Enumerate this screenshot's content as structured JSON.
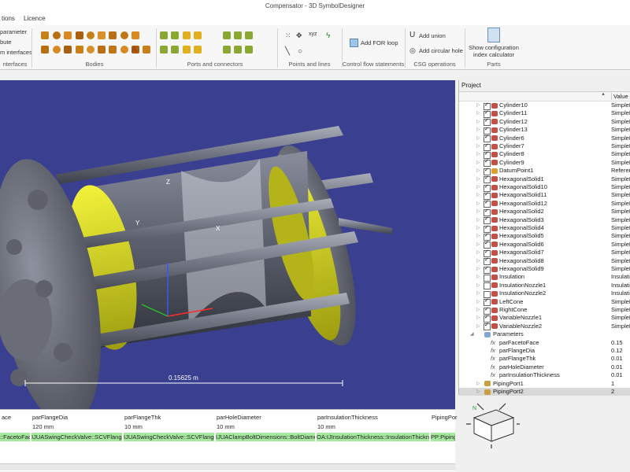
{
  "window": {
    "title": "Compensator - 3D SymbolDesigner"
  },
  "menu": {
    "items": [
      "tions",
      "Licence"
    ]
  },
  "ribbon": {
    "left_texts": [
      "parameter",
      "bute",
      "m interfaces"
    ],
    "groups": [
      "nterfaces",
      "Bodies",
      "Ports and connectors",
      "Points and lines",
      "Control flow statements",
      "CSG operations",
      "Parts"
    ],
    "add_for_loop": "Add FOR loop",
    "add_union": "Add union",
    "add_circular_hole": "Add circular hole",
    "show_config": "Show configuration index calculator"
  },
  "viewport": {
    "axes": {
      "x": "X",
      "y": "Y",
      "z": "Z"
    },
    "scale_label": "0.15625 m",
    "colors": {
      "background": "#3a3f8f",
      "metal": "#707482",
      "insulation": "#e5e51a"
    }
  },
  "grid": {
    "columns": [
      {
        "header": "ace",
        "value": "",
        "binding": "::FacetoFace"
      },
      {
        "header": "parFlangeDia",
        "value": "120 mm",
        "binding": "IJUASwingCheckValve::SCVFlangeDia"
      },
      {
        "header": "parFlangeThk",
        "value": "10 mm",
        "binding": "IJUASwingCheckValve::SCVFlangeThk"
      },
      {
        "header": "parHoleDiameter",
        "value": "10 mm",
        "binding": "IJUAClampBoltDimensions::BoltDiameter"
      },
      {
        "header": "parInsulationThickness",
        "value": "10 mm",
        "binding": "OA:IJInsulationThickness::InsulationThickness"
      },
      {
        "header": "PipingPor",
        "value": "",
        "binding": "PP:PipingP"
      }
    ]
  },
  "project": {
    "title": "Project",
    "value_header": "Value",
    "rows": [
      {
        "name": "Cylinder10",
        "value": "SimpleP",
        "type": "solid",
        "checked": true
      },
      {
        "name": "Cylinder11",
        "value": "SimpleP",
        "type": "solid",
        "checked": true
      },
      {
        "name": "Cylinder12",
        "value": "SimpleP",
        "type": "solid",
        "checked": true
      },
      {
        "name": "Cylinder13",
        "value": "SimpleP",
        "type": "solid",
        "checked": true
      },
      {
        "name": "Cylinder6",
        "value": "SimpleP",
        "type": "solid",
        "checked": true
      },
      {
        "name": "Cylinder7",
        "value": "SimpleP",
        "type": "solid",
        "checked": true
      },
      {
        "name": "Cylinder8",
        "value": "SimpleP",
        "type": "solid",
        "checked": true
      },
      {
        "name": "Cylinder9",
        "value": "SimpleP",
        "type": "solid",
        "checked": true
      },
      {
        "name": "DatumPoint1",
        "value": "Referen",
        "type": "datum",
        "checked": true
      },
      {
        "name": "HexagonalSolid1",
        "value": "SimpleP",
        "type": "solid",
        "checked": true
      },
      {
        "name": "HexagonalSolid10",
        "value": "SimpleP",
        "type": "solid",
        "checked": true
      },
      {
        "name": "HexagonalSolid11",
        "value": "SimpleP",
        "type": "solid",
        "checked": true
      },
      {
        "name": "HexagonalSolid12",
        "value": "SimpleP",
        "type": "solid",
        "checked": true
      },
      {
        "name": "HexagonalSolid2",
        "value": "SimpleP",
        "type": "solid",
        "checked": true
      },
      {
        "name": "HexagonalSolid3",
        "value": "SimpleP",
        "type": "solid",
        "checked": true
      },
      {
        "name": "HexagonalSolid4",
        "value": "SimpleP",
        "type": "solid",
        "checked": true
      },
      {
        "name": "HexagonalSolid5",
        "value": "SimpleP",
        "type": "solid",
        "checked": true
      },
      {
        "name": "HexagonalSolid6",
        "value": "SimpleP",
        "type": "solid",
        "checked": true
      },
      {
        "name": "HexagonalSolid7",
        "value": "SimpleP",
        "type": "solid",
        "checked": true
      },
      {
        "name": "HexagonalSolid8",
        "value": "SimpleP",
        "type": "solid",
        "checked": true
      },
      {
        "name": "HexagonalSolid9",
        "value": "SimpleP",
        "type": "solid",
        "checked": true
      },
      {
        "name": "Insulation",
        "value": "Insulatio",
        "type": "solid",
        "checked": false
      },
      {
        "name": "InsulationNozzle1",
        "value": "Insulatio",
        "type": "solid",
        "checked": false
      },
      {
        "name": "InsulationNozzle2",
        "value": "Insulatio",
        "type": "solid",
        "checked": false
      },
      {
        "name": "LeftCone",
        "value": "SimpleP",
        "type": "solid",
        "checked": true
      },
      {
        "name": "RightCone",
        "value": "SimpleP",
        "type": "solid",
        "checked": true
      },
      {
        "name": "VariableNozzle1",
        "value": "SimpleP",
        "type": "solid",
        "checked": true
      },
      {
        "name": "VariableNozzle2",
        "value": "SimpleP",
        "type": "solid",
        "checked": true
      }
    ],
    "parameters": {
      "label": "Parameters",
      "items": [
        {
          "name": "parFacetoFace",
          "value": "0.15"
        },
        {
          "name": "parFlangeDia",
          "value": "0.12"
        },
        {
          "name": "parFlangeThk",
          "value": "0.01"
        },
        {
          "name": "parHoleDiameter",
          "value": "0.01"
        },
        {
          "name": "parInsulationThickness",
          "value": "0.01"
        }
      ]
    },
    "ports": [
      {
        "name": "PipingPort1",
        "value": "1"
      },
      {
        "name": "PipingPort2",
        "value": "2"
      }
    ]
  }
}
